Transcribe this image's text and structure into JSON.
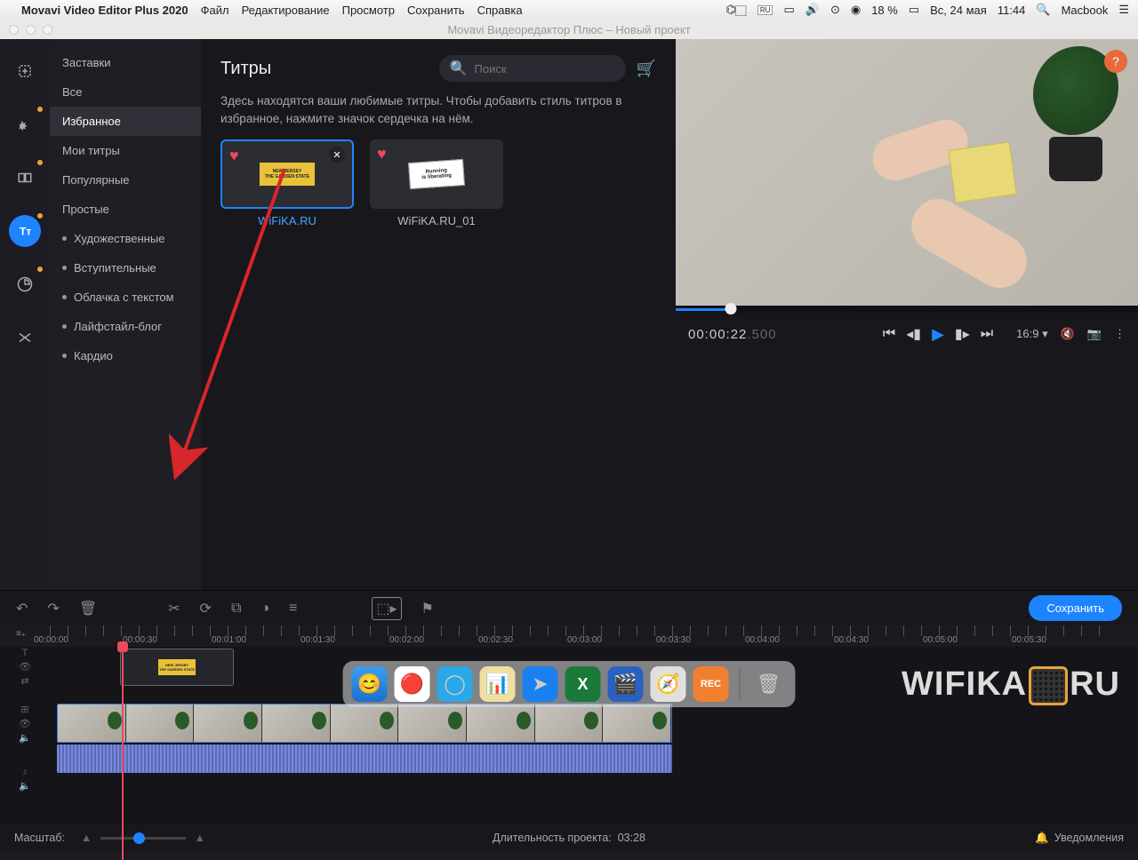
{
  "menubar": {
    "app": "Movavi Video Editor Plus 2020",
    "items": [
      "Файл",
      "Редактирование",
      "Просмотр",
      "Сохранить",
      "Справка"
    ],
    "battery": "18 %",
    "date": "Вс, 24 мая",
    "time": "11:44",
    "user": "Macbook"
  },
  "window": {
    "title": "Movavi Видеоредактор Плюс – Новый проект"
  },
  "rail": [
    {
      "name": "import-icon",
      "pip": false
    },
    {
      "name": "filters-icon",
      "pip": true
    },
    {
      "name": "transitions-icon",
      "pip": true
    },
    {
      "name": "titles-icon",
      "pip": true,
      "active": true
    },
    {
      "name": "stickers-icon",
      "pip": true
    },
    {
      "name": "tools-icon",
      "pip": false
    }
  ],
  "categories": [
    {
      "label": "Заставки"
    },
    {
      "label": "Все"
    },
    {
      "label": "Избранное",
      "selected": true
    },
    {
      "label": "Мои титры"
    },
    {
      "label": "Популярные"
    },
    {
      "label": "Простые"
    },
    {
      "label": "Художественные",
      "bullet": true
    },
    {
      "label": "Вступительные",
      "bullet": true
    },
    {
      "label": "Облачка с текстом",
      "bullet": true
    },
    {
      "label": "Лайфстайл-блог",
      "bullet": true
    },
    {
      "label": "Кардио",
      "bullet": true
    }
  ],
  "panel": {
    "heading": "Титры",
    "search_placeholder": "Поиск",
    "help_text": "Здесь находятся ваши любимые титры. Чтобы добавить стиль титров в избранное, нажмите значок сердечка на нём."
  },
  "thumbs": [
    {
      "label": "WiFiKA.RU",
      "stub_top": "NEW JERSEY",
      "stub_bottom": "THE GARDEN STATE",
      "selected": true,
      "removable": true
    },
    {
      "label": "WiFiKA.RU_01",
      "stub_top": "Running",
      "stub_bottom": "is liberating"
    }
  ],
  "preview": {
    "timecode_main": "00:00:22",
    "timecode_frac": ".500",
    "ratio": "16:9"
  },
  "toolbar": {
    "save": "Сохранить"
  },
  "ruler": [
    "00:00:00",
    "00:00:30",
    "00:01:00",
    "00:01:30",
    "00:02:00",
    "00:02:30",
    "00:03:00",
    "00:03:30",
    "00:04:00",
    "00:04:30",
    "00:05:00",
    "00:05:30"
  ],
  "footer": {
    "zoom_label": "Масштаб:",
    "duration_label": "Длительность проекта:",
    "duration_value": "03:28",
    "notifications": "Уведомления"
  },
  "title_clip": {
    "stub_top": "NEW JERSEY",
    "stub_bottom": "THE GARDEN STATE"
  },
  "watermark": {
    "left": "WIFIKA",
    "right": "RU"
  }
}
